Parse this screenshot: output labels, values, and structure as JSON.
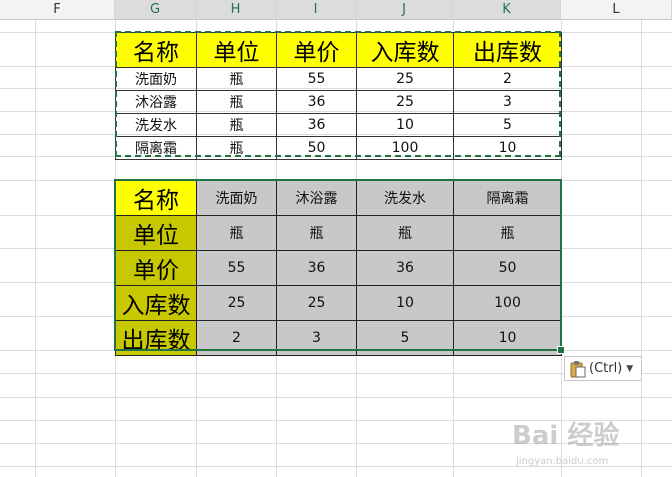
{
  "columns": {
    "F": "F",
    "G": "G",
    "H": "H",
    "I": "I",
    "J": "J",
    "K": "K",
    "L": "L"
  },
  "table1": {
    "headers": [
      "名称",
      "单位",
      "单价",
      "入库数",
      "出库数"
    ],
    "rows": [
      [
        "洗面奶",
        "瓶",
        "55",
        "25",
        "2"
      ],
      [
        "沐浴露",
        "瓶",
        "36",
        "25",
        "3"
      ],
      [
        "洗发水",
        "瓶",
        "36",
        "10",
        "5"
      ],
      [
        "隔离霜",
        "瓶",
        "50",
        "100",
        "10"
      ]
    ]
  },
  "table2": {
    "row_headers": [
      "名称",
      "单位",
      "单价",
      "入库数",
      "出库数"
    ],
    "rows": [
      [
        "洗面奶",
        "沐浴露",
        "洗发水",
        "隔离霜"
      ],
      [
        "瓶",
        "瓶",
        "瓶",
        "瓶"
      ],
      [
        "55",
        "36",
        "36",
        "50"
      ],
      [
        "25",
        "25",
        "10",
        "100"
      ],
      [
        "2",
        "3",
        "5",
        "10"
      ]
    ]
  },
  "paste_options": {
    "label": "(Ctrl)",
    "icon": "clipboard-icon",
    "dropdown_icon": "caret-down-icon"
  },
  "watermark": {
    "text": "Bai 经验",
    "sub": "jingyan.baidu.com"
  },
  "colors": {
    "header_fill": "#ffff00",
    "row_header_fill": "#c8c800",
    "cell_fill_transposed": "#c8c8c8",
    "selection": "#217346",
    "column_header_bg": "#f3f3f3"
  }
}
